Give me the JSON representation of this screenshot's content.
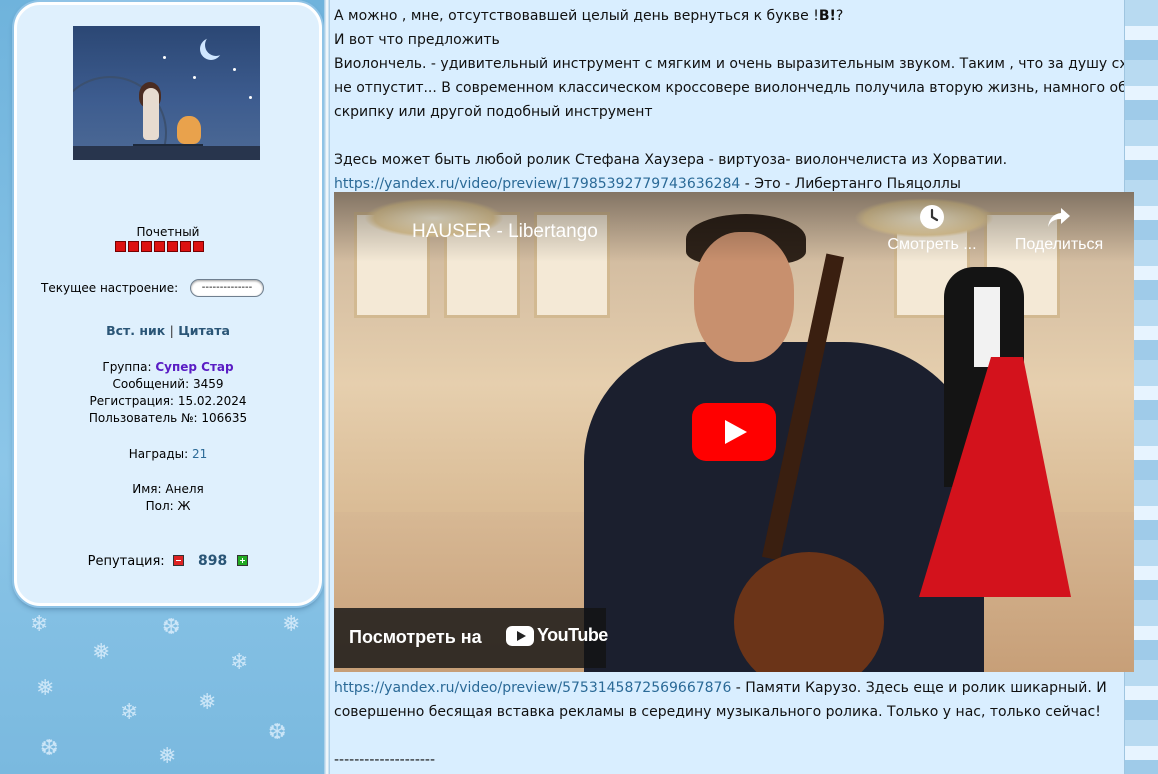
{
  "profile": {
    "rank_title": "Почетный",
    "rank_pips": 7,
    "mood_label": "Текущее настроение:",
    "mood_value": "--------------",
    "nick_link": "Вст. ник",
    "separator": "|",
    "quote_link": "Цитата",
    "group_label": "Группа:",
    "group_value": "Супер Стар",
    "posts_label": "Сообщений:",
    "posts_value": "3459",
    "reg_label": "Регистрация:",
    "reg_value": "15.02.2024",
    "user_no_label": "Пользователь №:",
    "user_no_value": "106635",
    "awards_label": "Награды:",
    "awards_value": "21",
    "name_label": "Имя:",
    "name_value": "Анеля",
    "gender_label": "Пол:",
    "gender_value": "Ж",
    "reputation_label": "Репутация:",
    "reputation_value": "898"
  },
  "post": {
    "line1_pre": "А можно , мне, отсутствовавшей целый день вернуться к букве !",
    "line1_bold": "В!",
    "line1_post": "?",
    "line2": "И вот что предложить",
    "line3": "Виолончель. - удивительный инструмент с мягким и очень выразительным звуком. Таким , что за душу схватит и",
    "line4": "не отпустит... В современном классическом кроссовере виолончедль получила вторую жизнь, намного обогнав",
    "line5": "скрипку или другой подобный инструмент",
    "line6": "Здесь может быть любой ролик Стефана Хаузера - виртуоза- виолончелиста из Хорватии.",
    "link1": "https://yandex.ru/video/preview/17985392779743636284",
    "link1_after": " - Это - Либертанго Пьяцоллы",
    "link2": "https://yandex.ru/video/preview/5753145872569667876",
    "link2_after": " - Памяти Карузо. Здесь еще и ролик шикарный. И",
    "line9": "совершенно бесящая вставка рекламы в середину музыкального ролика. Только у нас, только сейчас!",
    "signature_sep": "--------------------"
  },
  "video": {
    "title": "HAUSER - Libertango",
    "watch_later": "Смотреть ...",
    "share": "Поделиться",
    "watch_on": "Посмотреть на",
    "youtube": "YouTube"
  },
  "colors": {
    "link": "#2b6a97",
    "group": "#5a1cc4",
    "play": "#ff0000"
  }
}
